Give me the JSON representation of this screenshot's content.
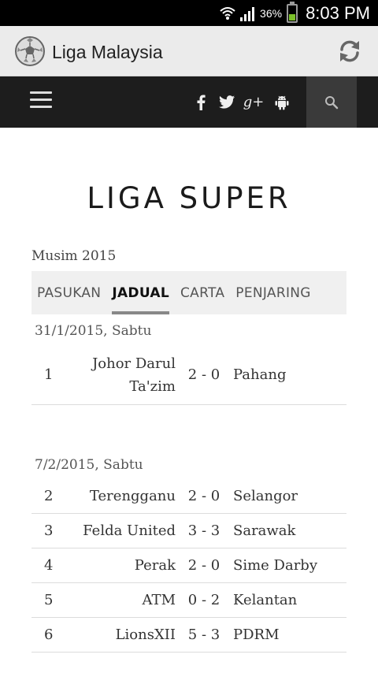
{
  "status_bar": {
    "battery_percent": "36%",
    "time": "8:03 PM",
    "battery_level": 0.36
  },
  "app_bar": {
    "title": "Liga Malaysia",
    "logo_icon": "soccer-ball-icon",
    "refresh_icon": "refresh-icon"
  },
  "site_nav": {
    "menu_icon": "hamburger-menu-icon",
    "social": [
      {
        "name": "facebook",
        "glyph": "f"
      },
      {
        "name": "twitter",
        "glyph": "twitter-bird"
      },
      {
        "name": "google-plus",
        "glyph": "g+"
      },
      {
        "name": "android",
        "glyph": "android"
      }
    ],
    "search_icon": "search-icon"
  },
  "page": {
    "title": "LIGA SUPER",
    "season": "Musim 2015",
    "tabs": [
      {
        "label": "PASUKAN",
        "active": false
      },
      {
        "label": "JADUAL",
        "active": true
      },
      {
        "label": "CARTA",
        "active": false
      },
      {
        "label": "PENJARING",
        "active": false
      }
    ]
  },
  "fixtures": [
    {
      "date": "31/1/2015, Sabtu",
      "matches": [
        {
          "no": "1",
          "home": "Johor Darul Ta'zim",
          "score": "2 - 0",
          "away": "Pahang"
        }
      ]
    },
    {
      "date": "7/2/2015, Sabtu",
      "matches": [
        {
          "no": "2",
          "home": "Terengganu",
          "score": "2 - 0",
          "away": "Selangor"
        },
        {
          "no": "3",
          "home": "Felda United",
          "score": "3 - 3",
          "away": "Sarawak"
        },
        {
          "no": "4",
          "home": "Perak",
          "score": "2 - 0",
          "away": "Sime Darby"
        },
        {
          "no": "5",
          "home": "ATM",
          "score": "0 - 2",
          "away": "Kelantan"
        },
        {
          "no": "6",
          "home": "LionsXII",
          "score": "5 - 3",
          "away": "PDRM"
        }
      ]
    }
  ]
}
